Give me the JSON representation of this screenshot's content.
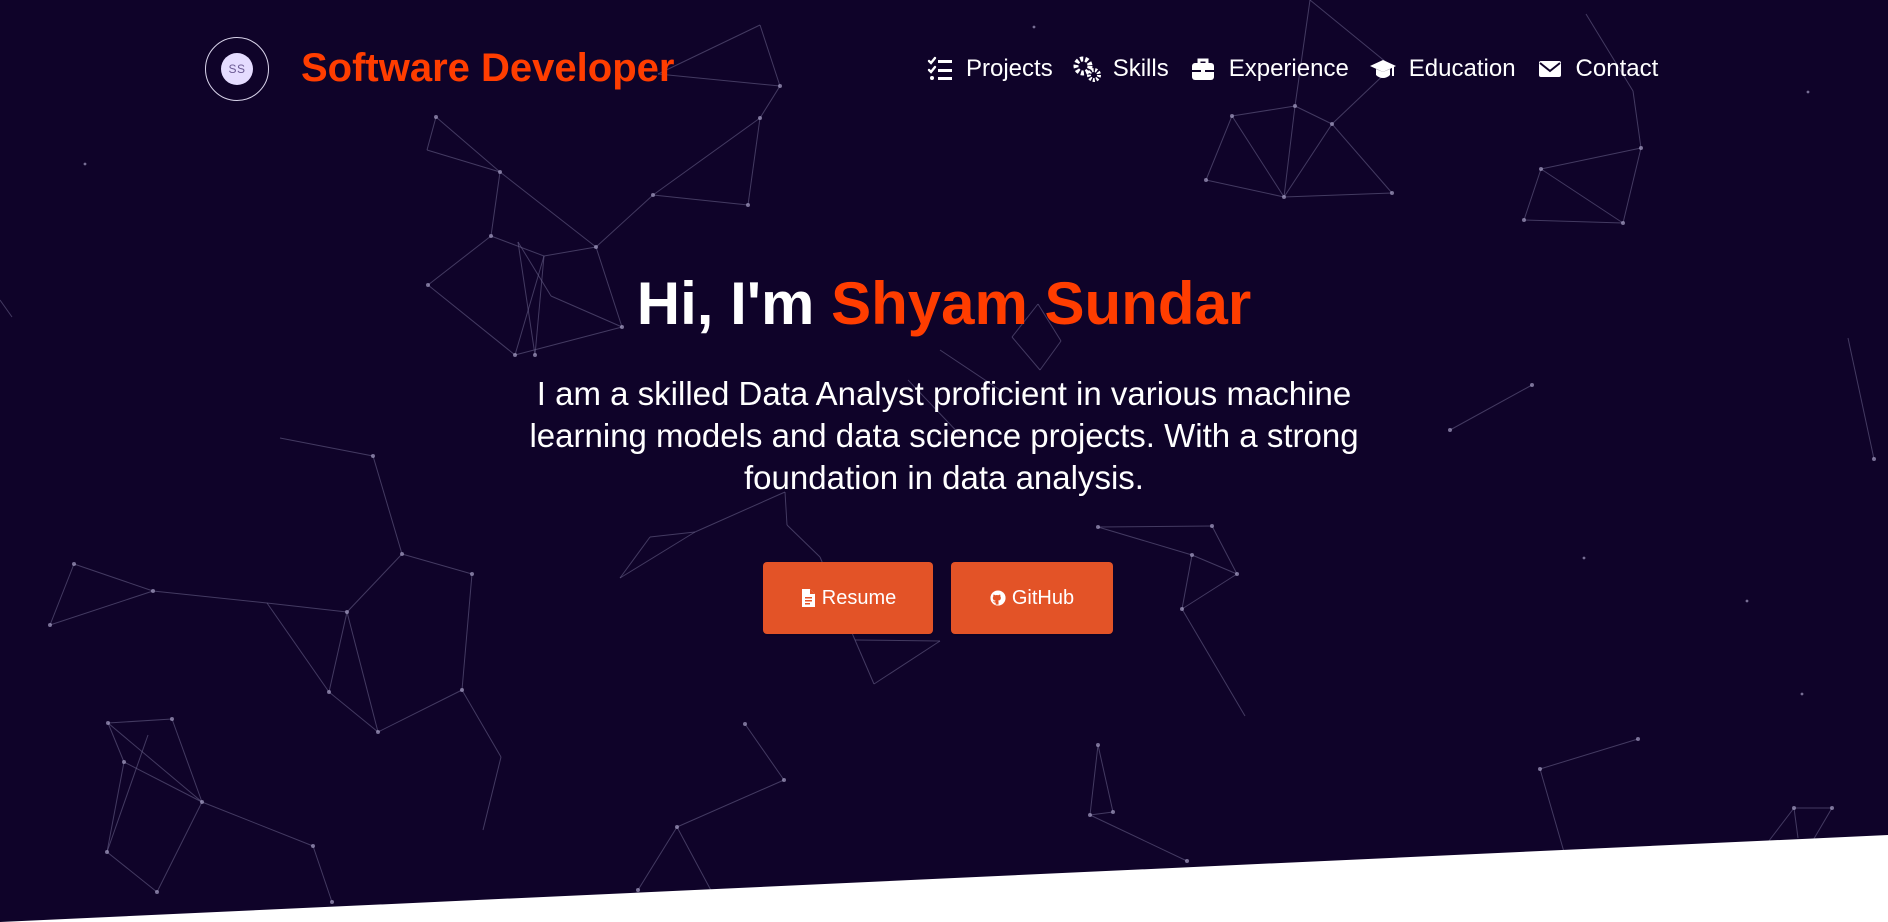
{
  "brand": {
    "logo_text": "SS",
    "title": "Software Developer"
  },
  "nav": {
    "items": [
      {
        "label": "Projects",
        "icon": "checklist-icon"
      },
      {
        "label": "Skills",
        "icon": "gears-icon"
      },
      {
        "label": "Experience",
        "icon": "briefcase-icon"
      },
      {
        "label": "Education",
        "icon": "graduation-cap-icon"
      },
      {
        "label": "Contact",
        "icon": "envelope-icon"
      }
    ]
  },
  "hero": {
    "greeting": "Hi, I'm",
    "name": "Shyam Sundar",
    "description": "I am a skilled Data Analyst proficient in various machine learning models and data science projects. With a strong foundation in data analysis."
  },
  "actions": {
    "resume_label": "Resume",
    "github_label": "GitHub"
  },
  "colors": {
    "background": "#0f0329",
    "accent": "#ff3d00",
    "button": "#e35327",
    "text": "#ffffff"
  }
}
